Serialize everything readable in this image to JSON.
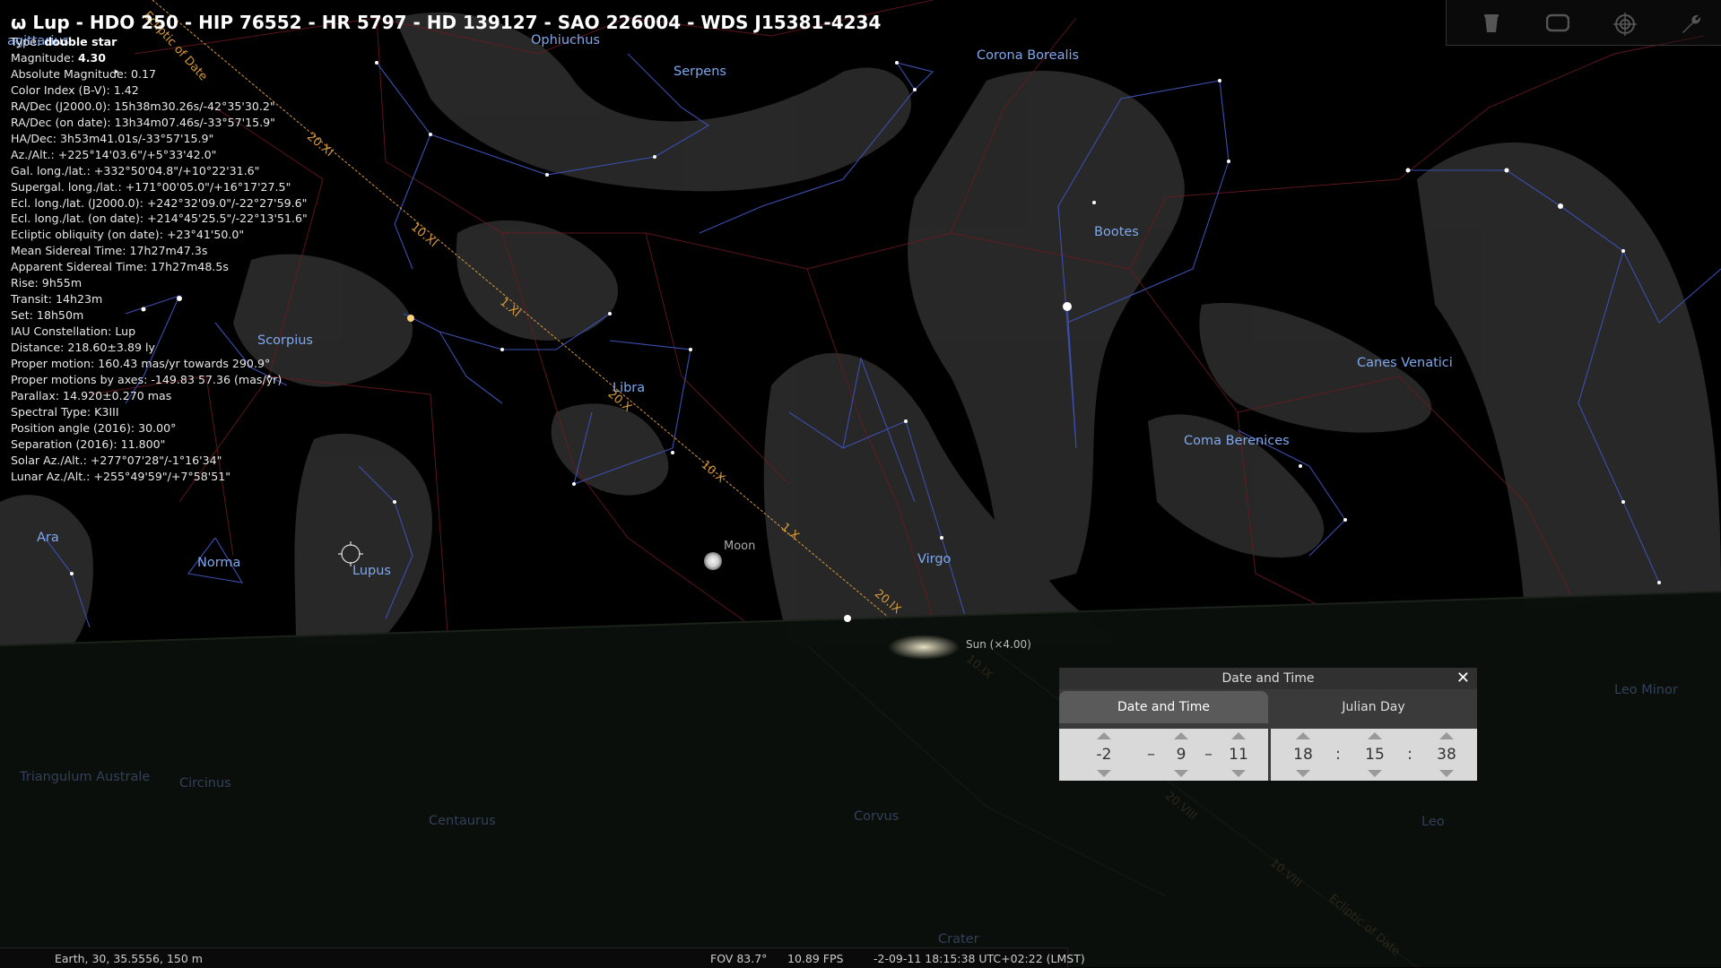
{
  "object": {
    "title": "ω Lup - HDO 250 - HIP 76552 - HR 5797 - HD 139127 - SAO 226004 - WDS J15381-4234",
    "type_label": "Type:",
    "type_value": "double star",
    "magnitude_label": "Magnitude:",
    "magnitude_value": "4.30",
    "lines": [
      "Absolute Magnitude: 0.17",
      "Color Index (B-V): 1.42",
      "RA/Dec (J2000.0): 15h38m30.26s/-42°35'30.2\"",
      "RA/Dec (on date): 13h34m07.46s/-33°57'15.9\"",
      "HA/Dec: 3h53m41.01s/-33°57'15.9\"",
      "Az./Alt.: +225°14'03.6\"/+5°33'42.0\"",
      "Gal. long./lat.: +332°50'04.8\"/+10°22'31.6\"",
      "Supergal. long./lat.: +171°00'05.0\"/+16°17'27.5\"",
      "Ecl. long./lat. (J2000.0): +242°32'09.0\"/-22°27'59.6\"",
      "Ecl. long./lat. (on date): +214°45'25.5\"/-22°13'51.6\"",
      "Ecliptic obliquity (on date): +23°41'50.0\"",
      "Mean Sidereal Time: 17h27m47.3s",
      "Apparent Sidereal Time: 17h27m48.5s",
      "Rise: 9h55m",
      "Transit: 14h23m",
      "Set: 18h50m",
      "IAU Constellation: Lup",
      "Distance: 218.60±3.89 ly",
      "Proper motion: 160.43 mas/yr towards 290.9°",
      "Proper motions by axes: -149.83 57.36 (mas/yr)",
      "Parallax: 14.920±0.270 mas",
      "Spectral Type: K3III",
      "Position angle (2016): 30.00°",
      "Separation (2016): 11.800\"",
      "Solar Az./Alt.: +277°07'28\"/-1°16'34\"",
      "Lunar Az./Alt.: +255°49'59\"/+7°58'51\""
    ]
  },
  "constellations": {
    "sagittarius": "agittarius",
    "ophiuchus": "Ophiuchus",
    "serpens": "Serpens",
    "corona_borealis": "Corona Borealis",
    "bootes": "Bootes",
    "canes_venatici": "Canes Venatici",
    "coma_berenices": "Coma Berenices",
    "scorpius": "Scorpius",
    "libra": "Libra",
    "virgo": "Virgo",
    "ara": "Ara",
    "norma": "Norma",
    "lupus": "Lupus",
    "triangulum_australe": "Triangulum Australe",
    "circinus": "Circinus",
    "centaurus": "Centaurus",
    "corvus": "Corvus",
    "leo": "Leo",
    "leo_minor": "Leo Minor",
    "crater": "Crater"
  },
  "ecliptic": {
    "label": "Ecliptic of Date",
    "ticks": [
      "20.XI",
      "10.XI",
      "1.XI",
      "20.X",
      "10.X",
      "1.X",
      "20.IX",
      "10.IX",
      "20.VIII",
      "10.VIII",
      "Ecliptic of Date"
    ]
  },
  "bodies": {
    "moon": "Moon",
    "sun": "Sun (×4.00)"
  },
  "status": {
    "location": "Earth, 30, 35.5556, 150 m",
    "fov": "FOV 83.7°",
    "fps": "10.89 FPS",
    "datetime": "-2-09-11 18:15:38 UTC+02:22 (LMST)"
  },
  "date_time_dialog": {
    "title": "Date and Time",
    "tab_date_time": "Date and Time",
    "tab_julian_day": "Julian Day",
    "year": "-2",
    "month": "9",
    "day": "11",
    "hour": "18",
    "minute": "15",
    "second": "38",
    "date_separator": "–",
    "time_separator": ":",
    "close_glyph": "✕"
  },
  "toolbar_icons": [
    "trash-icon",
    "screen-icon",
    "target-icon",
    "wrench-icon"
  ]
}
